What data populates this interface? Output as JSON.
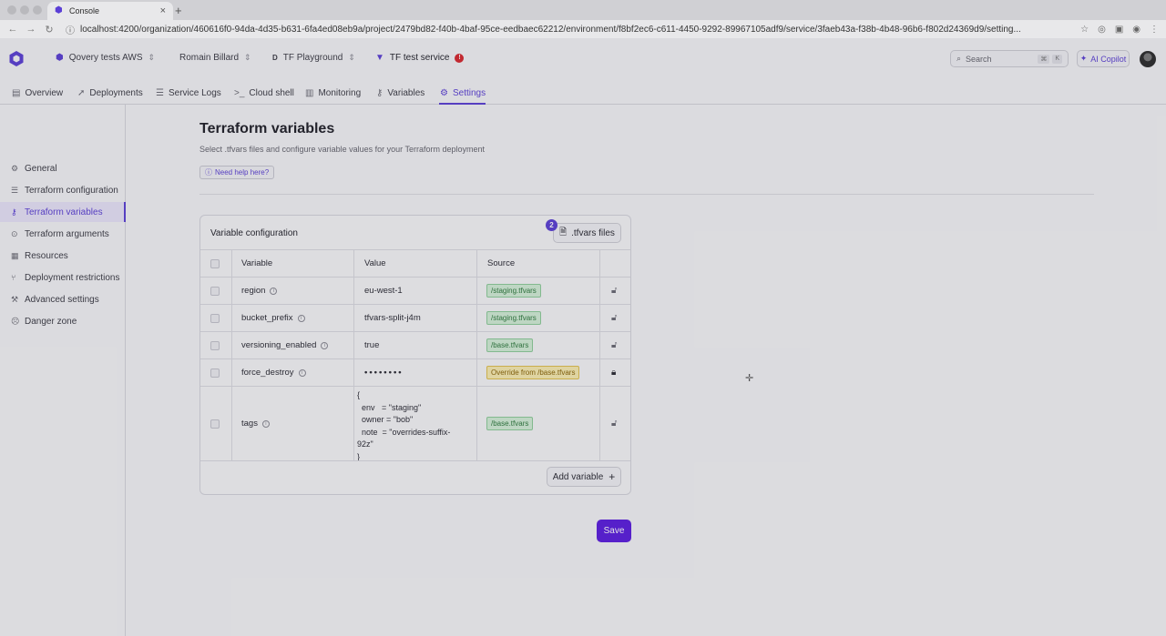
{
  "browser": {
    "tab_title": "Console",
    "url": "localhost:4200/organization/460616f0-94da-4d35-b631-6fa4ed08eb9a/project/2479bd82-f40b-4baf-95ce-eedbaec62212/environment/f8bf2ec6-c611-4450-9292-89967105adf9/service/3faeb43a-f38b-4b48-96b6-f802d24369d9/setting..."
  },
  "topnav": {
    "organization": "Qovery tests AWS",
    "user": "Romain Billard",
    "environment_prefix": "D",
    "environment": "TF Playground",
    "service": "TF test service",
    "search_placeholder": "Search",
    "search_shortcut": [
      "⌘",
      "K"
    ],
    "copilot": "AI Copilot"
  },
  "service_tabs": [
    "Overview",
    "Deployments",
    "Service Logs",
    "Cloud shell",
    "Monitoring",
    "Variables",
    "Settings"
  ],
  "sidebar": {
    "items": [
      "General",
      "Terraform configuration",
      "Terraform variables",
      "Terraform arguments",
      "Resources",
      "Deployment restrictions",
      "Advanced settings",
      "Danger zone"
    ],
    "active": "Terraform variables"
  },
  "main": {
    "title": "Terraform variables",
    "subtitle": "Select .tfvars files and configure variable values for your Terraform deployment",
    "help_button": "Need help here?",
    "card_title": "Variable configuration",
    "tfvars_button": ".tfvars files",
    "tfvars_count": "2",
    "columns": [
      "Variable",
      "Value",
      "Source"
    ],
    "rows": [
      {
        "variable": "region",
        "value": "eu-west-1",
        "source": "/staging.tfvars",
        "override": false,
        "locked": false
      },
      {
        "variable": "bucket_prefix",
        "value": "tfvars-split-j4m",
        "source": "/staging.tfvars",
        "override": false,
        "locked": false
      },
      {
        "variable": "versioning_enabled",
        "value": "true",
        "source": "/base.tfvars",
        "override": false,
        "locked": false
      },
      {
        "variable": "force_destroy",
        "value": "••••••••",
        "source": "Override from /base.tfvars",
        "override": true,
        "locked": true
      },
      {
        "variable": "tags",
        "value": "{\n  env   = \"staging\"\n  owner = \"bob\"\n  note  = \"overrides-suffix-\n92z\"\n}",
        "source": "/base.tfvars",
        "override": false,
        "locked": false
      }
    ],
    "add_variable": "Add variable",
    "save": "Save"
  },
  "colors": {
    "brand": "#5b3fd6",
    "save": "#5b1de0",
    "source_green": "#d4f0d8",
    "source_override": "#fbeeb0",
    "error": "#d9272e"
  }
}
